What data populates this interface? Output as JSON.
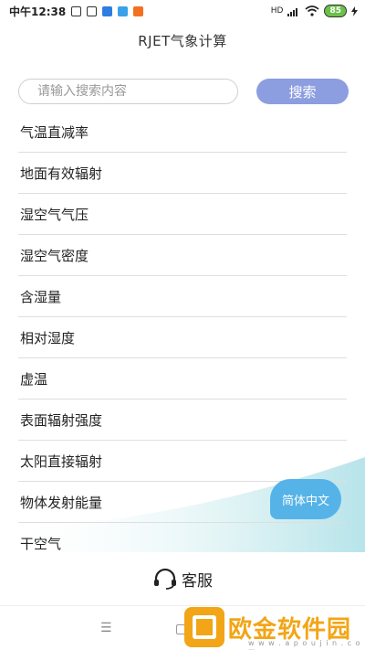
{
  "status_bar": {
    "time": "中午12:38",
    "network": "HD",
    "battery": "85"
  },
  "header": {
    "title": "RJET气象计算"
  },
  "search": {
    "placeholder": "请输入搜索内容",
    "button_label": "搜索"
  },
  "list": {
    "items": [
      "气温直减率",
      "地面有效辐射",
      "湿空气气压",
      "湿空气密度",
      "含湿量",
      "相对湿度",
      "虚温",
      "表面辐射强度",
      "太阳直接辐射",
      "物体发射能量",
      "干空气"
    ]
  },
  "language_button": {
    "label": "简体中文"
  },
  "service": {
    "label": "客服",
    "icon": "headset-icon"
  },
  "watermark": {
    "text": "欧金软件园",
    "url": "w w w . a p o u j i n . c o m"
  },
  "colors": {
    "search_button": "#8c9ee0",
    "language_bubble": "#55b3e8",
    "battery": "#6cc04a",
    "watermark": "#f2a516"
  }
}
